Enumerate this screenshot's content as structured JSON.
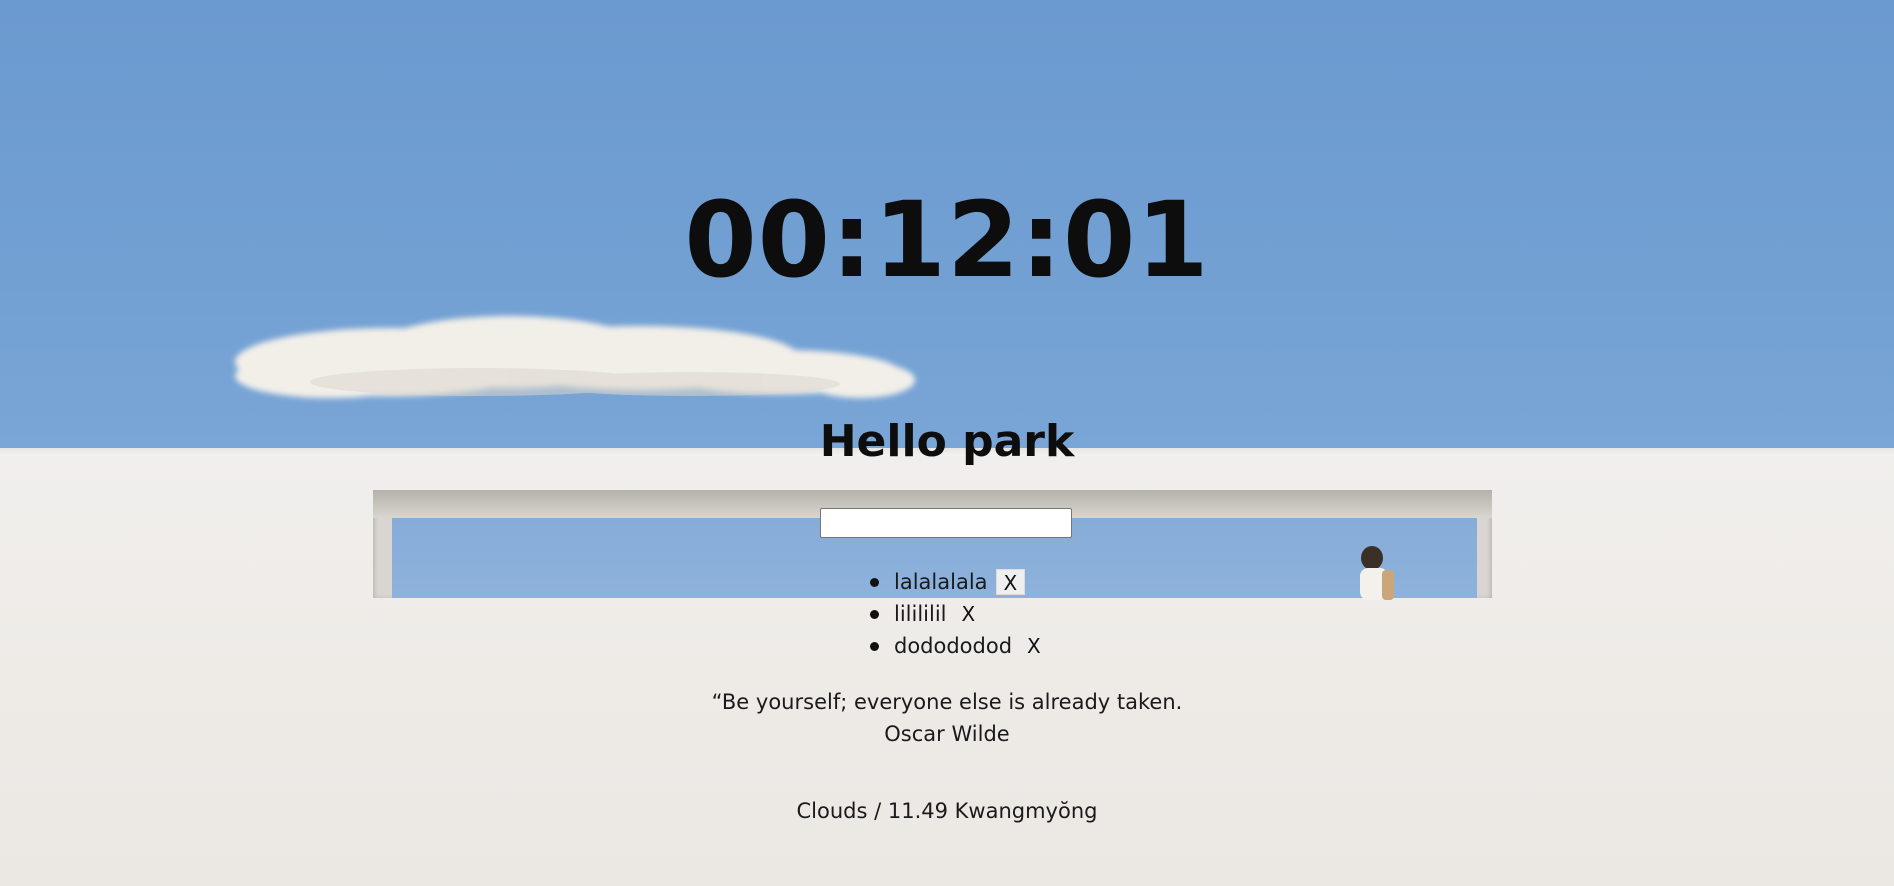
{
  "clock": {
    "time": "00:12:01"
  },
  "greeting": {
    "text": "Hello park"
  },
  "todo": {
    "input_value": "",
    "items": [
      {
        "label": "lalalalala",
        "delete_label": "X"
      },
      {
        "label": "lilililil",
        "delete_label": "X"
      },
      {
        "label": "dodododod",
        "delete_label": "X"
      }
    ]
  },
  "quote": {
    "text": "“Be yourself; everyone else is already taken.",
    "author": "Oscar Wilde"
  },
  "weather": {
    "text": "Clouds / 11.49 Kwangmyŏng"
  }
}
